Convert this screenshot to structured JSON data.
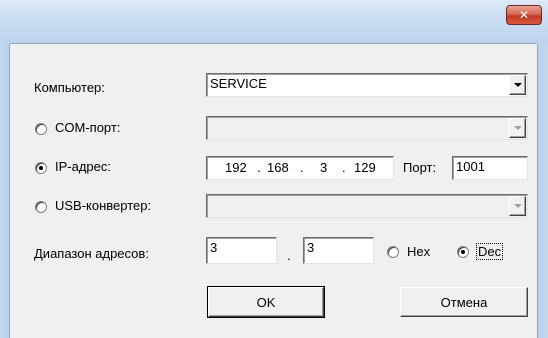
{
  "window": {
    "close_glyph": "✕"
  },
  "computer": {
    "label": "Компьютер:",
    "value": "SERVICE"
  },
  "com": {
    "label": "COM-порт:",
    "value": "",
    "selected": false
  },
  "ip": {
    "label": "IP-адрес:",
    "octets": [
      "192",
      "168",
      "3",
      "129"
    ],
    "dot": ".",
    "port_label": "Порт:",
    "port_value": "1001",
    "selected": true
  },
  "usb": {
    "label": "USB-конвертер:",
    "value": "",
    "selected": false
  },
  "range": {
    "label": "Диапазон адресов:",
    "from": "3",
    "to": "3",
    "separator": ".",
    "hex_label": "Hex",
    "dec_label": "Dec",
    "mode": "Dec"
  },
  "buttons": {
    "ok": "OK",
    "cancel": "Отмена"
  }
}
